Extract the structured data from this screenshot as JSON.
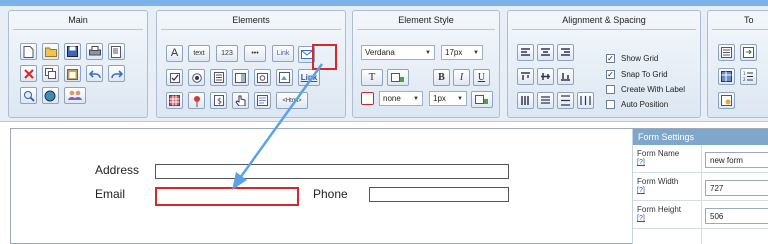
{
  "ribbon": {
    "groups": {
      "main": {
        "title": "Main"
      },
      "elements": {
        "title": "Elements",
        "text_btn": "text",
        "num_btn": "123",
        "dots_btn": "•••",
        "linkbox_btn": "Link",
        "link_btn": "Link",
        "html_btn": "<Html>"
      },
      "element_style": {
        "title": "Element Style",
        "font_family": "Verdana",
        "font_size": "17px",
        "bold": "B",
        "italic": "I",
        "underline": "U",
        "border_style": "none",
        "border_width": "1px",
        "t_btn": "T"
      },
      "alignment": {
        "title": "Alignment & Spacing",
        "show_grid": "Show Grid",
        "snap_to_grid": "Snap To Grid",
        "create_with_label": "Create With Label",
        "auto_position": "Auto Position"
      },
      "tools": {
        "title": "To"
      }
    },
    "checks": {
      "show_grid": "✓",
      "snap_to_grid": "✓"
    }
  },
  "form": {
    "address_label": "Address",
    "email_label": "Email",
    "phone_label": "Phone"
  },
  "settings": {
    "header": "Form Settings",
    "help": "[?]",
    "rows": [
      {
        "label": "Form Name",
        "value": "new form"
      },
      {
        "label": "Form Width",
        "value": "727"
      },
      {
        "label": "Form Height",
        "value": "506"
      }
    ]
  },
  "colors": {
    "accent": "#7ab4ea",
    "highlight": "#d9262b",
    "arrow": "#5ba3e6",
    "settings_header": "#7fa7cc"
  }
}
